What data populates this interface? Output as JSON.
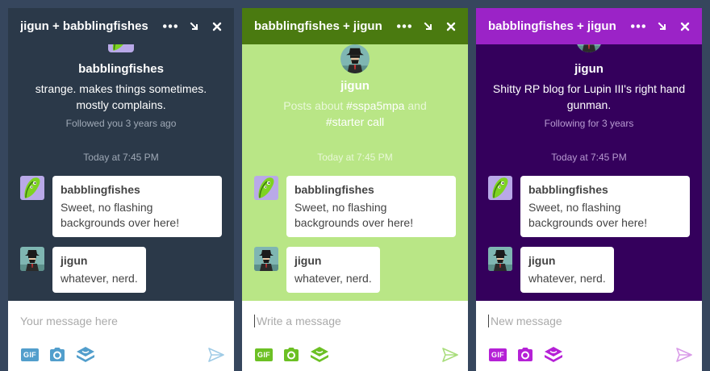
{
  "colors": {
    "page_background": "#36465d",
    "theme1_header": "#2b3949",
    "theme1_body": "#2b3949",
    "theme1_accent": "#529ecc",
    "theme2_header": "#4a7a10",
    "theme2_body": "#b9e686",
    "theme2_accent": "#6cc024",
    "theme3_header": "#9b23c7",
    "theme3_body": "#34005c",
    "theme3_accent": "#b521d6"
  },
  "panels": [
    {
      "header": {
        "title": "jigun + babblingfishes",
        "icons": [
          "more-icon",
          "minimize-icon",
          "close-icon"
        ]
      },
      "profile": {
        "name": "babblingfishes",
        "description": "strange. makes things sometimes. mostly complains.",
        "meta": "Followed you 3 years ago"
      },
      "timestamp": "Today at 7:45 PM",
      "messages": [
        {
          "sender": "babblingfishes",
          "text": "Sweet, no flashing backgrounds over here!"
        },
        {
          "sender": "jigun",
          "text": "whatever, nerd."
        }
      ],
      "composer": {
        "placeholder": "Your message here",
        "gif_label": "GIF",
        "tools": [
          "gif-icon",
          "camera-icon",
          "sticker-icon",
          "send-icon"
        ]
      }
    },
    {
      "header": {
        "title": "babblingfishes + jigun",
        "icons": [
          "more-icon",
          "minimize-icon",
          "close-icon"
        ]
      },
      "profile": {
        "name": "jigun",
        "description_prefix": "Posts about ",
        "description_tag1": "#sspa5mpa",
        "description_mid": " and",
        "description_tag2": "#starter call",
        "meta": ""
      },
      "timestamp": "Today at 7:45 PM",
      "messages": [
        {
          "sender": "babblingfishes",
          "text": "Sweet, no flashing backgrounds over here!"
        },
        {
          "sender": "jigun",
          "text": "whatever, nerd."
        }
      ],
      "composer": {
        "placeholder": "Write a message",
        "gif_label": "GIF",
        "tools": [
          "gif-icon",
          "camera-icon",
          "sticker-icon",
          "send-icon"
        ]
      }
    },
    {
      "header": {
        "title": "babblingfishes + jigun",
        "icons": [
          "more-icon",
          "minimize-icon",
          "close-icon"
        ]
      },
      "profile": {
        "name": "jigun",
        "description": "Shitty RP blog for Lupin III's right hand gunman.",
        "meta": "Following for 3 years"
      },
      "timestamp": "Today at 7:45 PM",
      "messages": [
        {
          "sender": "babblingfishes",
          "text": "Sweet, no flashing backgrounds over here!"
        },
        {
          "sender": "jigun",
          "text": "whatever, nerd."
        }
      ],
      "composer": {
        "placeholder": "New message",
        "gif_label": "GIF",
        "tools": [
          "gif-icon",
          "camera-icon",
          "sticker-icon",
          "send-icon"
        ]
      }
    }
  ]
}
